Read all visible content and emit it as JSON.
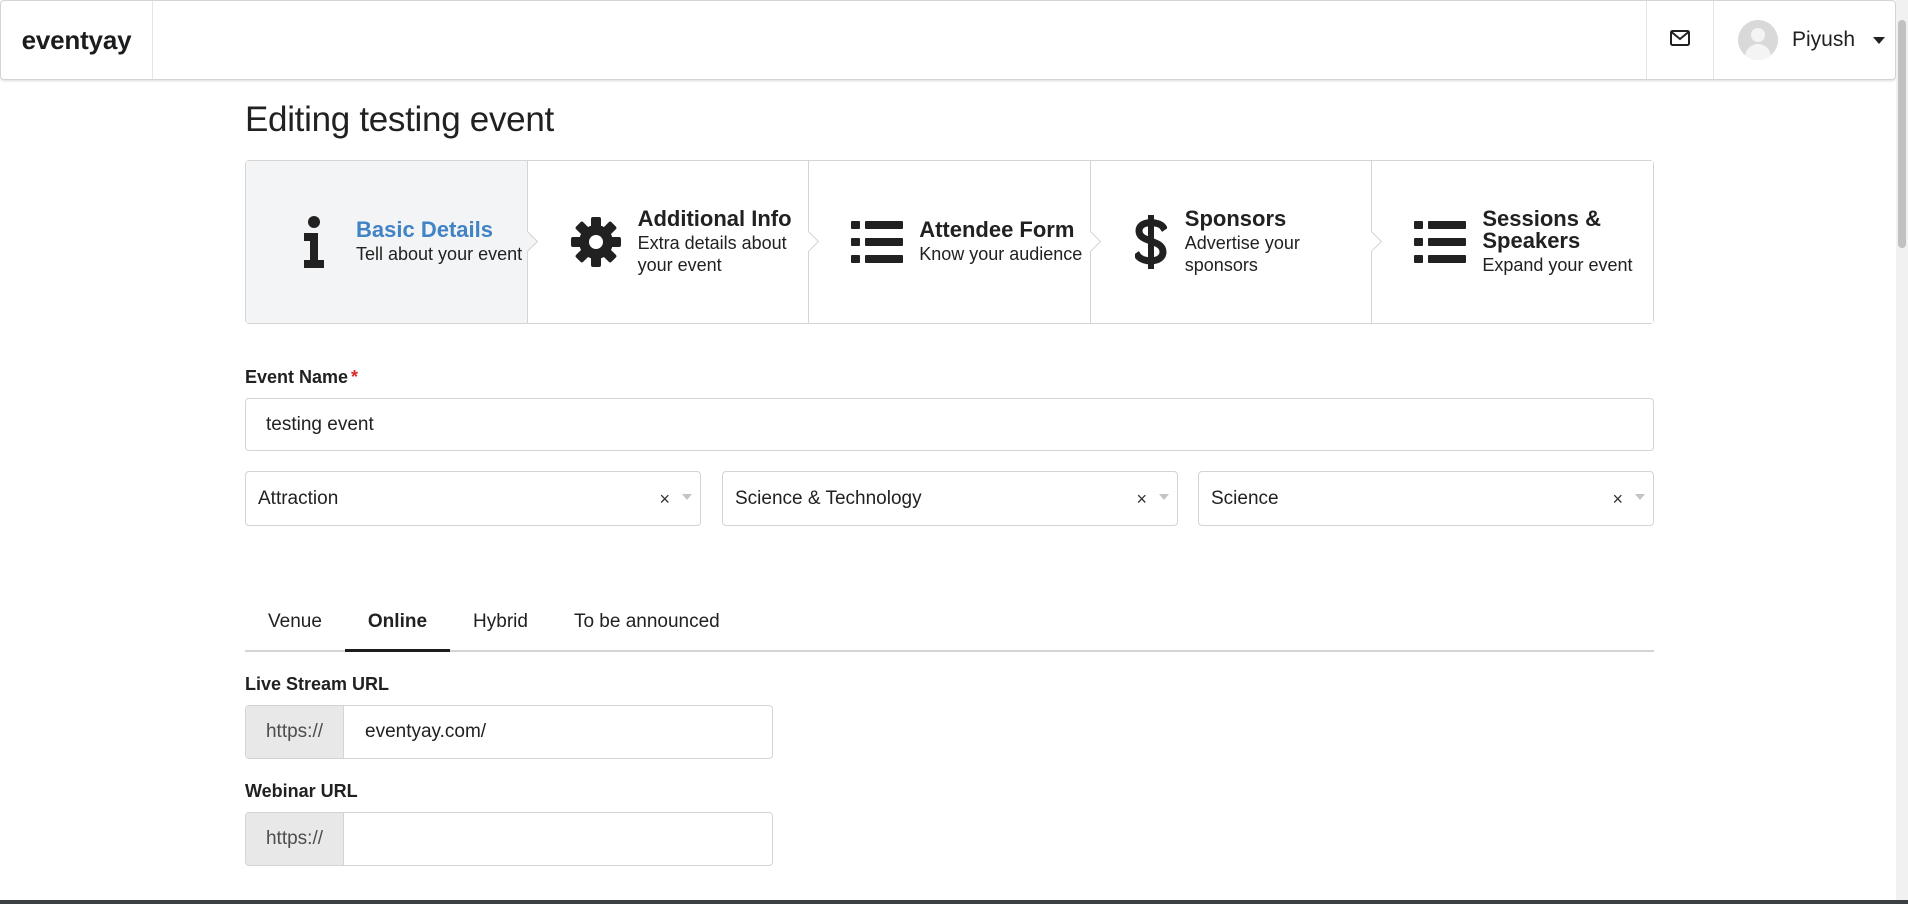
{
  "nav": {
    "brand": "eventyay",
    "mail_icon": "envelope-icon",
    "user_name": "Piyush"
  },
  "page": {
    "title": "Editing testing event"
  },
  "steps": [
    {
      "title": "Basic Details",
      "description": "Tell about your event",
      "icon": "info-icon",
      "active": true
    },
    {
      "title": "Additional Info",
      "description": "Extra details about your event",
      "icon": "gear-icon",
      "active": false
    },
    {
      "title": "Attendee Form",
      "description": "Know your audience",
      "icon": "list-icon",
      "active": false
    },
    {
      "title": "Sponsors",
      "description": "Advertise your sponsors",
      "icon": "dollar-icon",
      "active": false
    },
    {
      "title": "Sessions & Speakers",
      "description": "Expand your event",
      "icon": "list-icon",
      "active": false
    }
  ],
  "form": {
    "event_name_label": "Event Name",
    "required_mark": "*",
    "event_name_value": "testing event",
    "type_select": "Attraction",
    "topic_select": "Science & Technology",
    "subtopic_select": "Science",
    "clear_glyph": "×"
  },
  "location_tabs": [
    {
      "label": "Venue",
      "active": false
    },
    {
      "label": "Online",
      "active": true
    },
    {
      "label": "Hybrid",
      "active": false
    },
    {
      "label": "To be announced",
      "active": false
    }
  ],
  "online": {
    "live_stream_label": "Live Stream URL",
    "live_stream_prefix": "https://",
    "live_stream_value": "eventyay.com/",
    "webinar_label": "Webinar URL",
    "webinar_prefix": "https://",
    "webinar_value": ""
  }
}
